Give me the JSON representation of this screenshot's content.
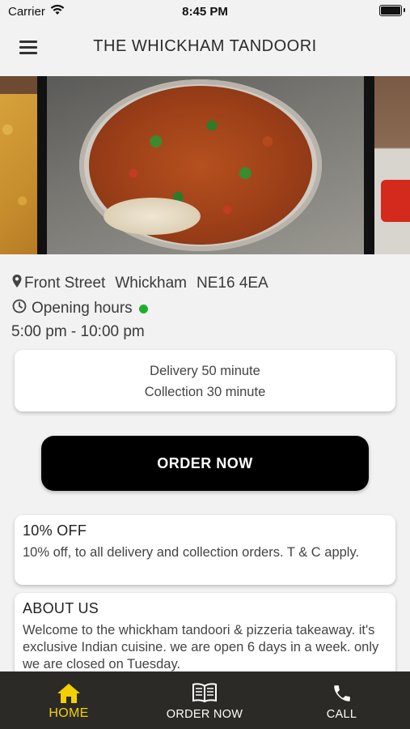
{
  "status_bar": {
    "carrier": "Carrier",
    "time": "8:45 PM"
  },
  "header": {
    "title": "THE WHICKHAM TANDOORI"
  },
  "location": {
    "street": "Front Street",
    "town": "Whickham",
    "postcode": "NE16 4EA",
    "opening_hours_label": "Opening hours",
    "open_status_color": "#1fae2b",
    "hours": "5:00 pm - 10:00 pm"
  },
  "times": {
    "delivery": "Delivery 50 minute",
    "collection": "Collection 30 minute"
  },
  "order_button": {
    "label": "ORDER NOW"
  },
  "offer": {
    "title": "10% OFF",
    "text": "10% off, to all delivery and collection orders. T & C apply."
  },
  "about": {
    "title": "ABOUT US",
    "text": "Welcome to the whickham tandoori & pizzeria takeaway. it's exclusive Indian cuisine. we are open 6 days in a week. only we are closed on Tuesday."
  },
  "tabs": [
    {
      "label": "HOME",
      "icon": "home-icon",
      "active": true
    },
    {
      "label": "ORDER NOW",
      "icon": "menu-book-icon",
      "active": false
    },
    {
      "label": "CALL",
      "icon": "phone-icon",
      "active": false
    }
  ],
  "colors": {
    "accent": "#f5d000",
    "tab_bar": "#2c2a27",
    "button": "#000000"
  }
}
